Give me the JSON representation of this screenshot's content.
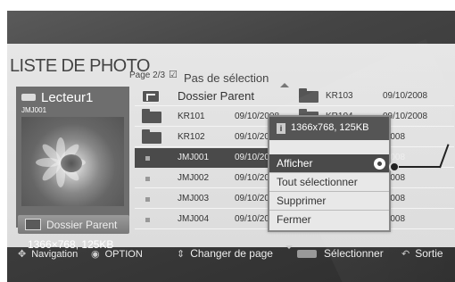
{
  "header": {
    "title": "LISTE DE PHOTO",
    "page_indicator": "Page 2/3",
    "selection_status": "Pas de sélection"
  },
  "device": {
    "name": "Lecteur1",
    "sub": "JMJ001",
    "resolution": "1366×768, 125KB",
    "parent_button": "Dossier Parent"
  },
  "files_left": [
    {
      "type": "parent",
      "name": "Dossier Parent",
      "date": ""
    },
    {
      "type": "folder",
      "name": "KR101",
      "date": "09/10/2008"
    },
    {
      "type": "folder",
      "name": "KR102",
      "date": "09/10/2008"
    },
    {
      "type": "photo",
      "name": "JMJ001",
      "date": "09/10/2008",
      "highlighted": true
    },
    {
      "type": "photo",
      "name": "JMJ002",
      "date": "09/10/2008"
    },
    {
      "type": "photo",
      "name": "JMJ003",
      "date": "09/10/2008"
    },
    {
      "type": "photo",
      "name": "JMJ004",
      "date": "09/10/2008"
    }
  ],
  "files_right": [
    {
      "type": "folder",
      "name": "KR103",
      "date": "09/10/2008"
    },
    {
      "type": "folder",
      "name": "KR104",
      "date": "09/10/2008"
    },
    {
      "type": "photo",
      "name": "",
      "date": "/2008"
    },
    {
      "type": "photo",
      "name": "",
      "date": "/2008"
    },
    {
      "type": "photo",
      "name": "",
      "date": "/2008"
    },
    {
      "type": "photo",
      "name": "",
      "date": "/2008"
    },
    {
      "type": "photo",
      "name": "",
      "date": "/2008"
    }
  ],
  "popup": {
    "info": "1366x768, 125KB",
    "items": [
      "Afficher",
      "Tout sélectionner",
      "Supprimer",
      "Fermer"
    ],
    "active_index": 0
  },
  "navbar": {
    "navigation": "Navigation",
    "option": "OPTION",
    "page_change": "Changer de page",
    "select": "Sélectionner",
    "exit": "Sortie"
  }
}
